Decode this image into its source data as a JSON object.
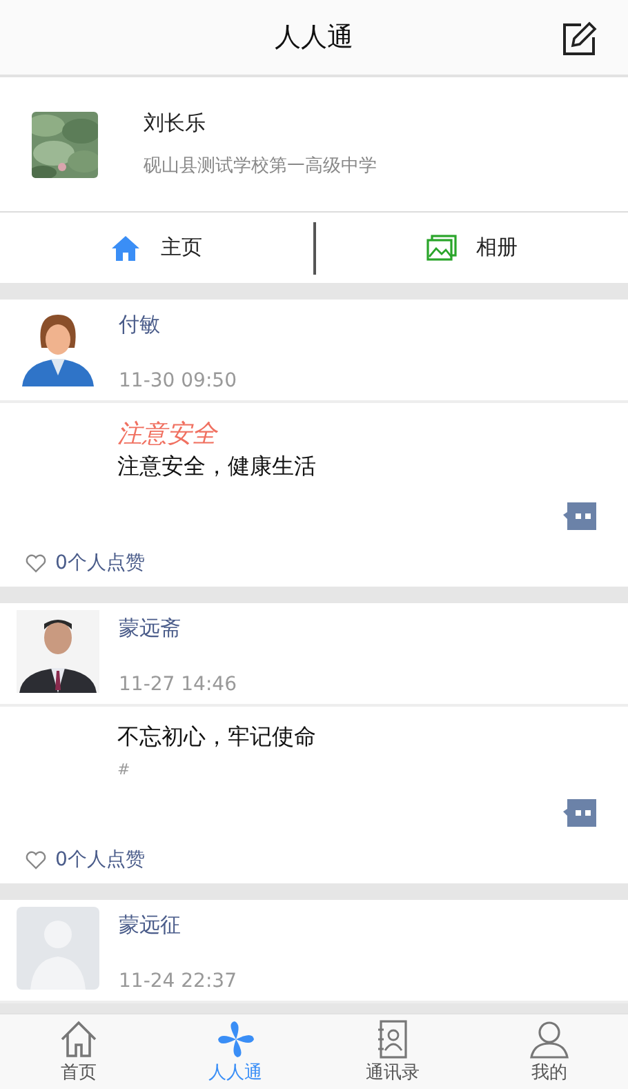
{
  "header": {
    "title": "人人通"
  },
  "profile": {
    "name": "刘长乐",
    "school": "砚山县测试学校第一高级中学"
  },
  "tabs": [
    {
      "label": "主页",
      "kind": "home"
    },
    {
      "label": "相册",
      "kind": "album"
    }
  ],
  "posts": [
    {
      "kind": "cartoon",
      "name": "付敏",
      "time": "11-30 09:50",
      "title": "注意安全",
      "text": "注意安全，健康生活",
      "likes": "0个人点赞"
    },
    {
      "name": "蒙远斋",
      "time": "11-27 14:46",
      "text": "不忘初心，牢记使命",
      "tag": "#",
      "likes": "0个人点赞"
    },
    {
      "kind": "placeholder",
      "name": "蒙远征",
      "time": "11-24 22:37"
    }
  ],
  "nav": [
    {
      "label": "首页",
      "kind": "home",
      "selected": false
    },
    {
      "label": "人人通",
      "kind": "pinwheel",
      "selected": true
    },
    {
      "label": "通讯录",
      "kind": "contacts",
      "selected": false
    },
    {
      "label": "我的",
      "kind": "user",
      "selected": false
    }
  ]
}
